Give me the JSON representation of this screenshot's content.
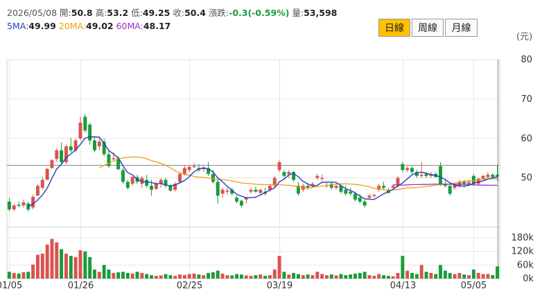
{
  "info": {
    "date": "2026/05/08",
    "open_label": "開:",
    "open": "50.8",
    "high_label": "高:",
    "high": "53.2",
    "low_label": "低:",
    "low": "49.25",
    "close_label": "收:",
    "close": "50.4",
    "change_label": "漲跌:",
    "change": "-0.3(-0.59%)",
    "volume_label": "量:",
    "volume": "53,598"
  },
  "ma": {
    "ma5_label": "5MA:",
    "ma5": "49.99",
    "ma20_label": "20MA:",
    "ma20": "49.02",
    "ma60_label": "60MA:",
    "ma60": "48.17"
  },
  "period_tabs": {
    "daily": "日線",
    "weekly": "周線",
    "monthly": "月線",
    "active": "daily"
  },
  "unit": "(元)",
  "colors": {
    "up": "#d9534f",
    "down": "#1a9b3a",
    "ma5": "#1f3fbf",
    "ma20": "#f39c12",
    "ma60": "#9b30c8",
    "grid": "#e6e6e6",
    "frame": "#d0d0d0",
    "tab_active": "#ffc000"
  },
  "chart_data": {
    "type": "candlestick",
    "price_ticks": [
      "80",
      "70",
      "60",
      "50"
    ],
    "volume_ticks": [
      "180k",
      "120k",
      "60k",
      "0k"
    ],
    "x_ticks": [
      "01/05",
      "01/26",
      "02/25",
      "03/19",
      "04/13",
      "05/05"
    ],
    "reference_price": 53.2,
    "ylim_price": [
      38,
      80
    ],
    "ylim_volume": [
      0,
      220000
    ],
    "candles": [
      {
        "date": "01/05",
        "o": 44,
        "h": 45,
        "l": 41.5,
        "c": 42,
        "v": 30000
      },
      {
        "o": 42,
        "h": 43.5,
        "l": 41.5,
        "c": 43,
        "v": 25000
      },
      {
        "o": 43.2,
        "h": 44,
        "l": 42.5,
        "c": 43,
        "v": 22000
      },
      {
        "o": 43,
        "h": 44.5,
        "l": 42.5,
        "c": 43.8,
        "v": 28000
      },
      {
        "o": 43.5,
        "h": 44,
        "l": 41.5,
        "c": 42,
        "v": 30000
      },
      {
        "o": 42.5,
        "h": 45.8,
        "l": 42,
        "c": 45.2,
        "v": 62000
      },
      {
        "o": 45.5,
        "h": 48.5,
        "l": 45.5,
        "c": 48,
        "v": 105000
      },
      {
        "o": 47.5,
        "h": 50.2,
        "l": 47,
        "c": 49.5,
        "v": 110000
      },
      {
        "o": 49.5,
        "h": 52.5,
        "l": 49.5,
        "c": 52.3,
        "v": 150000
      },
      {
        "o": 52.5,
        "h": 54.8,
        "l": 52.3,
        "c": 54.5,
        "v": 175000
      },
      {
        "o": 54.8,
        "h": 57.5,
        "l": 54,
        "c": 57,
        "v": 160000
      },
      {
        "o": 57,
        "h": 59,
        "l": 53.5,
        "c": 54,
        "v": 130000
      },
      {
        "o": 54,
        "h": 58.5,
        "l": 53.5,
        "c": 58,
        "v": 110000
      },
      {
        "o": 58,
        "h": 60.2,
        "l": 56.5,
        "c": 57,
        "v": 100000
      },
      {
        "o": 57,
        "h": 60,
        "l": 56.5,
        "c": 59.5,
        "v": 95000
      },
      {
        "date": "01/26",
        "o": 60,
        "h": 65.5,
        "l": 59.5,
        "c": 64,
        "v": 125000
      },
      {
        "o": 65.5,
        "h": 66.2,
        "l": 61.5,
        "c": 62,
        "v": 120000
      },
      {
        "o": 63.5,
        "h": 64,
        "l": 58.5,
        "c": 59.5,
        "v": 95000
      },
      {
        "o": 59.5,
        "h": 60.5,
        "l": 56.5,
        "c": 57,
        "v": 40000
      },
      {
        "o": 58,
        "h": 60,
        "l": 57,
        "c": 59.2,
        "v": 30000
      },
      {
        "o": 59.2,
        "h": 60,
        "l": 55.5,
        "c": 56,
        "v": 60000
      },
      {
        "o": 56,
        "h": 57,
        "l": 52.5,
        "c": 53,
        "v": 40000
      },
      {
        "o": 54.8,
        "h": 56.5,
        "l": 54.5,
        "c": 55,
        "v": 25000
      },
      {
        "o": 55,
        "h": 55.5,
        "l": 52,
        "c": 52.2,
        "v": 28000
      },
      {
        "o": 52,
        "h": 52.5,
        "l": 48.5,
        "c": 49,
        "v": 30000
      },
      {
        "o": 49,
        "h": 49.5,
        "l": 47,
        "c": 47.5,
        "v": 25000
      },
      {
        "o": 48.5,
        "h": 50.5,
        "l": 48,
        "c": 50.2,
        "v": 22000
      },
      {
        "o": 50.2,
        "h": 50.8,
        "l": 48.5,
        "c": 49,
        "v": 30000
      },
      {
        "o": 48.5,
        "h": 50.5,
        "l": 47.5,
        "c": 50,
        "v": 25000
      },
      {
        "o": 49.5,
        "h": 50.8,
        "l": 47.5,
        "c": 48,
        "v": 20000
      },
      {
        "o": 48,
        "h": 49.5,
        "l": 45.5,
        "c": 47,
        "v": 15000
      },
      {
        "o": 47.2,
        "h": 49,
        "l": 47,
        "c": 48.5,
        "v": 12000
      },
      {
        "o": 48.5,
        "h": 50,
        "l": 47.5,
        "c": 49.5,
        "v": 14000
      },
      {
        "o": 49.5,
        "h": 50,
        "l": 47.5,
        "c": 48,
        "v": 20000
      },
      {
        "o": 48,
        "h": 48.5,
        "l": 46.5,
        "c": 46.8,
        "v": 15000
      },
      {
        "o": 47,
        "h": 49,
        "l": 46.5,
        "c": 48.5,
        "v": 12000
      },
      {
        "o": 49,
        "h": 51.5,
        "l": 48.5,
        "c": 51,
        "v": 18000
      },
      {
        "o": 51,
        "h": 53.2,
        "l": 50.5,
        "c": 52.5,
        "v": 16000
      },
      {
        "date": "02/25",
        "o": 52,
        "h": 53.2,
        "l": 51.5,
        "c": 52.8,
        "v": 20000
      },
      {
        "o": 53,
        "h": 53.8,
        "l": 52.5,
        "c": 53,
        "v": 22000
      },
      {
        "o": 52.5,
        "h": 53.5,
        "l": 51.5,
        "c": 52,
        "v": 18000
      },
      {
        "o": 52.2,
        "h": 53,
        "l": 51.5,
        "c": 52.5,
        "v": 15000
      },
      {
        "o": 52.5,
        "h": 54,
        "l": 50.5,
        "c": 51,
        "v": 25000
      },
      {
        "o": 51,
        "h": 52,
        "l": 48.5,
        "c": 49,
        "v": 28000
      },
      {
        "o": 49,
        "h": 49.5,
        "l": 43.5,
        "c": 45.5,
        "v": 35000
      },
      {
        "o": 46,
        "h": 47.5,
        "l": 45,
        "c": 47,
        "v": 22000
      },
      {
        "o": 46.5,
        "h": 47.5,
        "l": 45.8,
        "c": 46.8,
        "v": 15000
      },
      {
        "o": 47,
        "h": 47.5,
        "l": 45.5,
        "c": 46,
        "v": 14000
      },
      {
        "o": 45,
        "h": 45.5,
        "l": 43.5,
        "c": 44,
        "v": 20000
      },
      {
        "o": 44.2,
        "h": 44.5,
        "l": 42.5,
        "c": 43,
        "v": 18000
      },
      {
        "o": 44.5,
        "h": 45.2,
        "l": 43.5,
        "c": 45,
        "v": 14000
      },
      {
        "o": 46.5,
        "h": 47.5,
        "l": 46,
        "c": 47,
        "v": 12000
      },
      {
        "o": 47,
        "h": 47.8,
        "l": 46.2,
        "c": 46.5,
        "v": 15000
      },
      {
        "o": 46.2,
        "h": 47.2,
        "l": 45.5,
        "c": 47,
        "v": 18000
      },
      {
        "o": 46.5,
        "h": 47.5,
        "l": 45.5,
        "c": 46,
        "v": 12000
      },
      {
        "o": 47,
        "h": 48.5,
        "l": 46.5,
        "c": 48,
        "v": 15000
      },
      {
        "o": 48,
        "h": 50.5,
        "l": 47.5,
        "c": 50,
        "v": 40000
      },
      {
        "date": "03/19",
        "o": 52,
        "h": 54.5,
        "l": 51.5,
        "c": 54,
        "v": 100000
      },
      {
        "o": 51.5,
        "h": 52,
        "l": 50,
        "c": 50.5,
        "v": 30000
      },
      {
        "o": 51,
        "h": 52,
        "l": 50,
        "c": 51.5,
        "v": 18000
      },
      {
        "o": 51.5,
        "h": 51.8,
        "l": 49,
        "c": 49.5,
        "v": 25000
      },
      {
        "o": 48,
        "h": 49,
        "l": 45.5,
        "c": 46,
        "v": 20000
      },
      {
        "o": 47,
        "h": 48.5,
        "l": 46.5,
        "c": 48,
        "v": 15000
      },
      {
        "o": 48,
        "h": 48.5,
        "l": 47,
        "c": 47.5,
        "v": 18000
      },
      {
        "o": 48,
        "h": 49,
        "l": 47.5,
        "c": 48.5,
        "v": 15000
      },
      {
        "o": 50,
        "h": 51,
        "l": 49.5,
        "c": 50.5,
        "v": 30000
      },
      {
        "o": 49.8,
        "h": 50.8,
        "l": 49.2,
        "c": 50,
        "v": 20000
      },
      {
        "o": 48,
        "h": 48.8,
        "l": 47.5,
        "c": 48.2,
        "v": 15000
      },
      {
        "o": 48.5,
        "h": 49,
        "l": 47,
        "c": 47.5,
        "v": 18000
      },
      {
        "o": 47.5,
        "h": 48.5,
        "l": 47,
        "c": 48,
        "v": 14000
      },
      {
        "o": 48,
        "h": 48.5,
        "l": 46,
        "c": 46.5,
        "v": 20000
      },
      {
        "o": 47,
        "h": 48,
        "l": 45.5,
        "c": 46,
        "v": 15000
      },
      {
        "o": 46.5,
        "h": 47.5,
        "l": 45.5,
        "c": 46,
        "v": 18000
      },
      {
        "o": 46,
        "h": 46.5,
        "l": 44,
        "c": 44.5,
        "v": 22000
      },
      {
        "o": 45,
        "h": 46,
        "l": 43.5,
        "c": 44,
        "v": 25000
      },
      {
        "o": 44,
        "h": 44.5,
        "l": 42.5,
        "c": 43,
        "v": 30000
      },
      {
        "o": 45,
        "h": 46,
        "l": 44.5,
        "c": 45.5,
        "v": 15000
      },
      {
        "o": 45.5,
        "h": 46,
        "l": 45,
        "c": 45.7,
        "v": 12000
      },
      {
        "o": 47,
        "h": 48.5,
        "l": 46.5,
        "c": 48,
        "v": 20000
      },
      {
        "o": 48,
        "h": 49,
        "l": 47,
        "c": 47.5,
        "v": 15000
      },
      {
        "o": 47,
        "h": 47.5,
        "l": 46,
        "c": 46.2,
        "v": 12000
      },
      {
        "o": 47.5,
        "h": 48.5,
        "l": 47,
        "c": 48,
        "v": 10000
      },
      {
        "o": 48,
        "h": 50.5,
        "l": 47.5,
        "c": 50,
        "v": 25000
      },
      {
        "date": "04/13",
        "o": 53.5,
        "h": 54,
        "l": 51.5,
        "c": 52,
        "v": 100000
      },
      {
        "o": 52,
        "h": 53,
        "l": 51.5,
        "c": 52.5,
        "v": 35000
      },
      {
        "o": 52.5,
        "h": 53,
        "l": 51,
        "c": 51.5,
        "v": 25000
      },
      {
        "o": 51.5,
        "h": 52,
        "l": 50,
        "c": 50.5,
        "v": 20000
      },
      {
        "o": 50.5,
        "h": 54,
        "l": 50,
        "c": 50.8,
        "v": 60000
      },
      {
        "o": 51,
        "h": 51.5,
        "l": 50,
        "c": 50.5,
        "v": 30000
      },
      {
        "o": 50.5,
        "h": 51.5,
        "l": 50,
        "c": 51,
        "v": 25000
      },
      {
        "o": 51,
        "h": 51.5,
        "l": 50,
        "c": 50.2,
        "v": 20000
      },
      {
        "o": 53,
        "h": 54,
        "l": 48,
        "c": 48.5,
        "v": 60000
      },
      {
        "o": 48.5,
        "h": 49.5,
        "l": 47.5,
        "c": 48,
        "v": 35000
      },
      {
        "o": 48,
        "h": 48.5,
        "l": 45.5,
        "c": 46,
        "v": 25000
      },
      {
        "o": 47.5,
        "h": 48.5,
        "l": 47,
        "c": 48.2,
        "v": 20000
      },
      {
        "o": 48,
        "h": 49.5,
        "l": 47.5,
        "c": 49,
        "v": 25000
      },
      {
        "o": 49,
        "h": 49.5,
        "l": 47.5,
        "c": 48.5,
        "v": 18000
      },
      {
        "o": 48.5,
        "h": 49.5,
        "l": 48,
        "c": 49,
        "v": 15000
      },
      {
        "date": "05/05",
        "o": 50.5,
        "h": 51,
        "l": 48,
        "c": 48.5,
        "v": 40000
      },
      {
        "o": 48.5,
        "h": 50,
        "l": 48,
        "c": 49.8,
        "v": 25000
      },
      {
        "o": 49.8,
        "h": 50.8,
        "l": 49.5,
        "c": 50.5,
        "v": 20000
      },
      {
        "o": 50.2,
        "h": 51.5,
        "l": 50,
        "c": 50.8,
        "v": 20000
      },
      {
        "o": 50.8,
        "h": 51.2,
        "l": 50,
        "c": 50.2,
        "v": 15000
      },
      {
        "date": "05/08",
        "o": 50.8,
        "h": 53.2,
        "l": 49.25,
        "c": 50.4,
        "v": 53598
      }
    ],
    "ma60_start_index": 81
  }
}
